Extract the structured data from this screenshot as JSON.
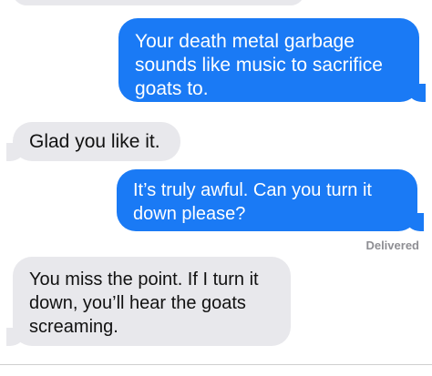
{
  "conversation": {
    "messages": [
      {
        "sender": "me",
        "text": "Your death metal garbage sounds like music to sacrifice goats to."
      },
      {
        "sender": "them",
        "text": "Glad you like it."
      },
      {
        "sender": "me",
        "text": "It’s truly awful. Can you turn it down please?"
      },
      {
        "sender": "them",
        "text": "You miss the point. If I turn it down, you’ll hear the goats screaming."
      }
    ],
    "status": "Delivered"
  },
  "colors": {
    "sent_bubble": "#1a7af5",
    "received_bubble": "#e8e8ec",
    "background": "#ffffff"
  }
}
